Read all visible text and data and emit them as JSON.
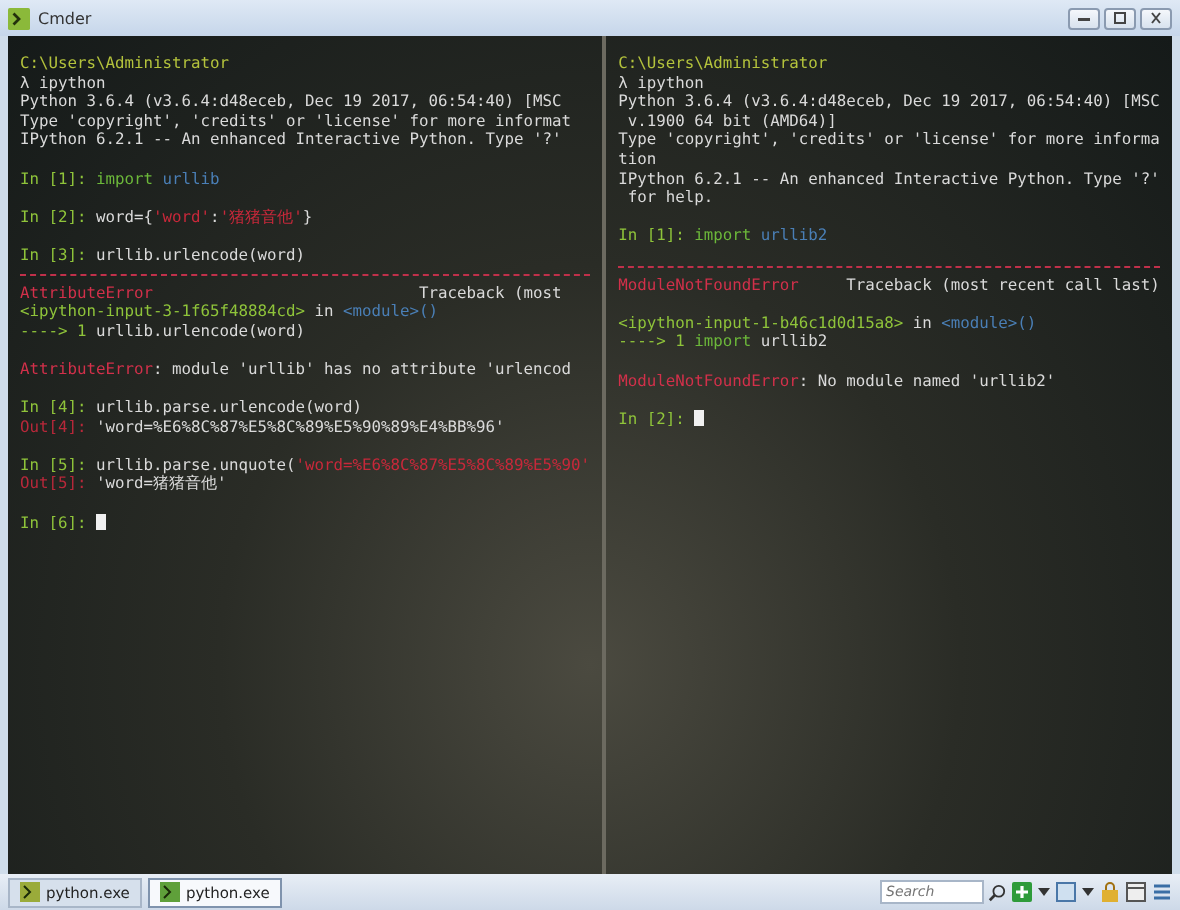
{
  "window": {
    "title": "Cmder"
  },
  "panes": [
    {
      "blocks": [
        {
          "lines": [
            {
              "kind": "text",
              "segments": [
                {
                  "kind": "path",
                  "text": "C:\\Users\\Administrator"
                }
              ]
            },
            {
              "kind": "text",
              "segments": [
                {
                  "kind": "plain",
                  "text": "λ ipython"
                }
              ]
            },
            {
              "kind": "text",
              "segments": [
                {
                  "kind": "plain",
                  "text": "Python 3.6.4 (v3.6.4:d48eceb, Dec 19 2017, 06:54:40) [MSC"
                }
              ]
            },
            {
              "kind": "text",
              "segments": [
                {
                  "kind": "plain",
                  "text": "Type 'copyright', 'credits' or 'license' for more informat"
                }
              ]
            },
            {
              "kind": "text",
              "segments": [
                {
                  "kind": "plain",
                  "text": "IPython 6.2.1 -- An enhanced Interactive Python. Type '?'"
                }
              ]
            }
          ]
        },
        {
          "lines": [
            {
              "kind": "text",
              "segments": [
                {
                  "kind": "prompt",
                  "text": "In [1]: "
                },
                {
                  "kind": "keyword",
                  "text": "import "
                },
                {
                  "kind": "name",
                  "text": "urllib"
                }
              ]
            }
          ]
        },
        {
          "lines": [
            {
              "kind": "text",
              "segments": [
                {
                  "kind": "prompt",
                  "text": "In [2]: "
                },
                {
                  "kind": "plain",
                  "text": "word={"
                },
                {
                  "kind": "string",
                  "text": "'word'"
                },
                {
                  "kind": "plain",
                  "text": ":"
                },
                {
                  "kind": "string",
                  "text": "'猪猪音他'"
                },
                {
                  "kind": "plain",
                  "text": "}"
                }
              ]
            }
          ]
        },
        {
          "lines": [
            {
              "kind": "text",
              "segments": [
                {
                  "kind": "prompt",
                  "text": "In [3]: "
                },
                {
                  "kind": "plain",
                  "text": "urllib.urlencode(word)"
                }
              ]
            },
            {
              "kind": "rule"
            },
            {
              "kind": "text",
              "segments": [
                {
                  "kind": "error",
                  "text": "AttributeError"
                },
                {
                  "kind": "plain",
                  "text": "                            Traceback (most"
                }
              ]
            },
            {
              "kind": "text",
              "segments": [
                {
                  "kind": "prompt",
                  "text": "<ipython-input-3-1f65f48884cd>"
                },
                {
                  "kind": "plain",
                  "text": " in "
                },
                {
                  "kind": "name",
                  "text": "<module>()"
                }
              ]
            },
            {
              "kind": "text",
              "segments": [
                {
                  "kind": "prompt",
                  "text": "----> 1 "
                },
                {
                  "kind": "plain",
                  "text": "urllib.urlencode(word)"
                }
              ]
            }
          ]
        },
        {
          "lines": [
            {
              "kind": "text",
              "segments": [
                {
                  "kind": "error",
                  "text": "AttributeError"
                },
                {
                  "kind": "plain",
                  "text": ": module 'urllib' has no attribute 'urlencod"
                }
              ]
            }
          ]
        },
        {
          "lines": [
            {
              "kind": "text",
              "segments": [
                {
                  "kind": "prompt",
                  "text": "In [4]: "
                },
                {
                  "kind": "plain",
                  "text": "urllib.parse.urlencode(word)"
                }
              ]
            },
            {
              "kind": "text",
              "segments": [
                {
                  "kind": "out",
                  "text": "Out[4]: "
                },
                {
                  "kind": "plain",
                  "text": "'word=%E6%8C%87%E5%8C%89%E5%90%89%E4%BB%96'"
                }
              ]
            }
          ]
        },
        {
          "lines": [
            {
              "kind": "text",
              "segments": [
                {
                  "kind": "prompt",
                  "text": "In [5]: "
                },
                {
                  "kind": "plain",
                  "text": "urllib.parse.unquote("
                },
                {
                  "kind": "string",
                  "text": "'word=%E6%8C%87%E5%8C%89%E5%90'"
                }
              ]
            },
            {
              "kind": "text",
              "segments": [
                {
                  "kind": "out",
                  "text": "Out[5]: "
                },
                {
                  "kind": "plain",
                  "text": "'word=猪猪音他'"
                }
              ]
            }
          ]
        },
        {
          "lines": [
            {
              "kind": "text",
              "segments": [
                {
                  "kind": "prompt",
                  "text": "In [6]: "
                },
                {
                  "kind": "cursor"
                }
              ]
            }
          ]
        }
      ]
    },
    {
      "blocks": [
        {
          "lines": [
            {
              "kind": "text",
              "segments": [
                {
                  "kind": "path",
                  "text": "C:\\Users\\Administrator"
                }
              ]
            },
            {
              "kind": "text",
              "segments": [
                {
                  "kind": "plain",
                  "text": "λ ipython"
                }
              ]
            },
            {
              "kind": "text",
              "segments": [
                {
                  "kind": "plain",
                  "text": "Python 3.6.4 (v3.6.4:d48eceb, Dec 19 2017, 06:54:40) [MSC"
                }
              ]
            },
            {
              "kind": "text",
              "segments": [
                {
                  "kind": "plain",
                  "text": " v.1900 64 bit (AMD64)]"
                }
              ]
            },
            {
              "kind": "text",
              "segments": [
                {
                  "kind": "plain",
                  "text": "Type 'copyright', 'credits' or 'license' for more informa"
                }
              ]
            },
            {
              "kind": "text",
              "segments": [
                {
                  "kind": "plain",
                  "text": "tion"
                }
              ]
            },
            {
              "kind": "text",
              "segments": [
                {
                  "kind": "plain",
                  "text": "IPython 6.2.1 -- An enhanced Interactive Python. Type '?'"
                }
              ]
            },
            {
              "kind": "text",
              "segments": [
                {
                  "kind": "plain",
                  "text": " for help."
                }
              ]
            }
          ]
        },
        {
          "lines": [
            {
              "kind": "text",
              "segments": [
                {
                  "kind": "prompt",
                  "text": "In [1]: "
                },
                {
                  "kind": "keyword",
                  "text": "import "
                },
                {
                  "kind": "name",
                  "text": "urllib2"
                }
              ]
            }
          ]
        },
        {
          "lines": [
            {
              "kind": "rule"
            },
            {
              "kind": "text",
              "segments": [
                {
                  "kind": "error",
                  "text": "ModuleNotFoundError"
                },
                {
                  "kind": "plain",
                  "text": "     Traceback (most recent call last)"
                }
              ]
            }
          ]
        },
        {
          "lines": [
            {
              "kind": "text",
              "segments": [
                {
                  "kind": "prompt",
                  "text": "<ipython-input-1-b46c1d0d15a8>"
                },
                {
                  "kind": "plain",
                  "text": " in "
                },
                {
                  "kind": "name",
                  "text": "<module>()"
                }
              ]
            },
            {
              "kind": "text",
              "segments": [
                {
                  "kind": "prompt",
                  "text": "----> 1 "
                },
                {
                  "kind": "keyword",
                  "text": "import "
                },
                {
                  "kind": "plain",
                  "text": "urllib2"
                }
              ]
            }
          ]
        },
        {
          "lines": [
            {
              "kind": "text",
              "segments": [
                {
                  "kind": "error",
                  "text": "ModuleNotFoundError"
                },
                {
                  "kind": "plain",
                  "text": ": No module named 'urllib2'"
                }
              ]
            }
          ]
        },
        {
          "lines": [
            {
              "kind": "text",
              "segments": [
                {
                  "kind": "prompt",
                  "text": "In [2]: "
                },
                {
                  "kind": "cursor"
                }
              ]
            }
          ]
        }
      ]
    }
  ],
  "taskbar": {
    "tabs": [
      {
        "label": "python.exe",
        "selected": false
      },
      {
        "label": "python.exe",
        "selected": true
      }
    ],
    "search": {
      "placeholder": "Search"
    }
  }
}
